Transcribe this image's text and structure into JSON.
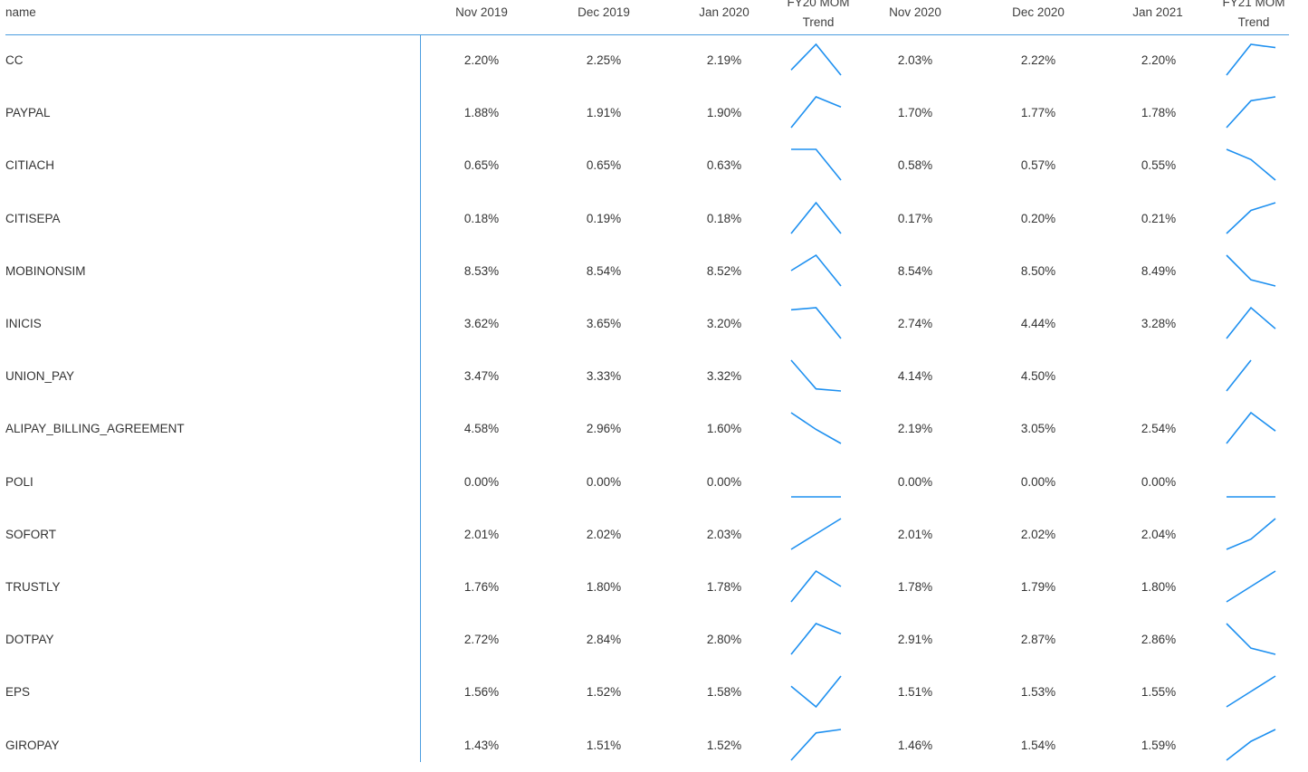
{
  "table": {
    "columns": [
      "name",
      "Nov 2019",
      "Dec 2019",
      "Jan 2020",
      "FY20 MOM Trend",
      "Nov 2020",
      "Dec 2020",
      "Jan 2021",
      "FY21 MOM Trend"
    ],
    "header": {
      "name": "name",
      "nov_2019": "Nov 2019",
      "dec_2019": "Dec 2019",
      "jan_2020": "Jan 2020",
      "fy20_trend_line1": "FY20 MOM",
      "fy20_trend_line2": "Trend",
      "nov_2020": "Nov 2020",
      "dec_2020": "Dec 2020",
      "jan_2021": "Jan 2021",
      "fy21_trend_line1": "FY21 MOM",
      "fy21_trend_line2": "Trend"
    },
    "sparkline_color": "#1e90f0",
    "rule_color": "#4a9de0",
    "rows": [
      {
        "name": "CC",
        "nov_2019": "2.20%",
        "dec_2019": "2.25%",
        "jan_2020": "2.19%",
        "nov_2020": "2.03%",
        "dec_2020": "2.22%",
        "jan_2021": "2.20%",
        "fy20_trend": [
          2.2,
          2.25,
          2.19
        ],
        "fy21_trend": [
          2.03,
          2.22,
          2.2
        ]
      },
      {
        "name": "PAYPAL",
        "nov_2019": "1.88%",
        "dec_2019": "1.91%",
        "jan_2020": "1.90%",
        "nov_2020": "1.70%",
        "dec_2020": "1.77%",
        "jan_2021": "1.78%",
        "fy20_trend": [
          1.88,
          1.91,
          1.9
        ],
        "fy21_trend": [
          1.7,
          1.77,
          1.78
        ]
      },
      {
        "name": "CITIACH",
        "nov_2019": "0.65%",
        "dec_2019": "0.65%",
        "jan_2020": "0.63%",
        "nov_2020": "0.58%",
        "dec_2020": "0.57%",
        "jan_2021": "0.55%",
        "fy20_trend": [
          0.65,
          0.65,
          0.63
        ],
        "fy21_trend": [
          0.58,
          0.57,
          0.55
        ]
      },
      {
        "name": "CITISEPA",
        "nov_2019": "0.18%",
        "dec_2019": "0.19%",
        "jan_2020": "0.18%",
        "nov_2020": "0.17%",
        "dec_2020": "0.20%",
        "jan_2021": "0.21%",
        "fy20_trend": [
          0.18,
          0.19,
          0.18
        ],
        "fy21_trend": [
          0.17,
          0.2,
          0.21
        ]
      },
      {
        "name": "MOBINONSIM",
        "nov_2019": "8.53%",
        "dec_2019": "8.54%",
        "jan_2020": "8.52%",
        "nov_2020": "8.54%",
        "dec_2020": "8.50%",
        "jan_2021": "8.49%",
        "fy20_trend": [
          8.53,
          8.54,
          8.52
        ],
        "fy21_trend": [
          8.54,
          8.5,
          8.49
        ]
      },
      {
        "name": "INICIS",
        "nov_2019": "3.62%",
        "dec_2019": "3.65%",
        "jan_2020": "3.20%",
        "nov_2020": "2.74%",
        "dec_2020": "4.44%",
        "jan_2021": "3.28%",
        "fy20_trend": [
          3.62,
          3.65,
          3.2
        ],
        "fy21_trend": [
          2.74,
          4.44,
          3.28
        ]
      },
      {
        "name": "UNION_PAY",
        "nov_2019": "3.47%",
        "dec_2019": "3.33%",
        "jan_2020": "3.32%",
        "nov_2020": "4.14%",
        "dec_2020": "4.50%",
        "jan_2021": "",
        "fy20_trend": [
          3.47,
          3.33,
          3.32
        ],
        "fy21_trend": [
          4.14,
          4.5
        ]
      },
      {
        "name": "ALIPAY_BILLING_AGREEMENT",
        "nov_2019": "4.58%",
        "dec_2019": "2.96%",
        "jan_2020": "1.60%",
        "nov_2020": "2.19%",
        "dec_2020": "3.05%",
        "jan_2021": "2.54%",
        "fy20_trend": [
          4.58,
          2.96,
          1.6
        ],
        "fy21_trend": [
          2.19,
          3.05,
          2.54
        ]
      },
      {
        "name": "POLI",
        "nov_2019": "0.00%",
        "dec_2019": "0.00%",
        "jan_2020": "0.00%",
        "nov_2020": "0.00%",
        "dec_2020": "0.00%",
        "jan_2021": "0.00%",
        "fy20_trend": [
          0.0,
          0.0,
          0.0
        ],
        "fy21_trend": [
          0.0,
          0.0,
          0.0
        ]
      },
      {
        "name": "SOFORT",
        "nov_2019": "2.01%",
        "dec_2019": "2.02%",
        "jan_2020": "2.03%",
        "nov_2020": "2.01%",
        "dec_2020": "2.02%",
        "jan_2021": "2.04%",
        "fy20_trend": [
          2.01,
          2.02,
          2.03
        ],
        "fy21_trend": [
          2.01,
          2.02,
          2.04
        ]
      },
      {
        "name": "TRUSTLY",
        "nov_2019": "1.76%",
        "dec_2019": "1.80%",
        "jan_2020": "1.78%",
        "nov_2020": "1.78%",
        "dec_2020": "1.79%",
        "jan_2021": "1.80%",
        "fy20_trend": [
          1.76,
          1.8,
          1.78
        ],
        "fy21_trend": [
          1.78,
          1.79,
          1.8
        ]
      },
      {
        "name": "DOTPAY",
        "nov_2019": "2.72%",
        "dec_2019": "2.84%",
        "jan_2020": "2.80%",
        "nov_2020": "2.91%",
        "dec_2020": "2.87%",
        "jan_2021": "2.86%",
        "fy20_trend": [
          2.72,
          2.84,
          2.8
        ],
        "fy21_trend": [
          2.91,
          2.87,
          2.86
        ]
      },
      {
        "name": "EPS",
        "nov_2019": "1.56%",
        "dec_2019": "1.52%",
        "jan_2020": "1.58%",
        "nov_2020": "1.51%",
        "dec_2020": "1.53%",
        "jan_2021": "1.55%",
        "fy20_trend": [
          1.56,
          1.52,
          1.58
        ],
        "fy21_trend": [
          1.51,
          1.53,
          1.55
        ]
      },
      {
        "name": "GIROPAY",
        "nov_2019": "1.43%",
        "dec_2019": "1.51%",
        "jan_2020": "1.52%",
        "nov_2020": "1.46%",
        "dec_2020": "1.54%",
        "jan_2021": "1.59%",
        "fy20_trend": [
          1.43,
          1.51,
          1.52
        ],
        "fy21_trend": [
          1.46,
          1.54,
          1.59
        ]
      }
    ]
  }
}
